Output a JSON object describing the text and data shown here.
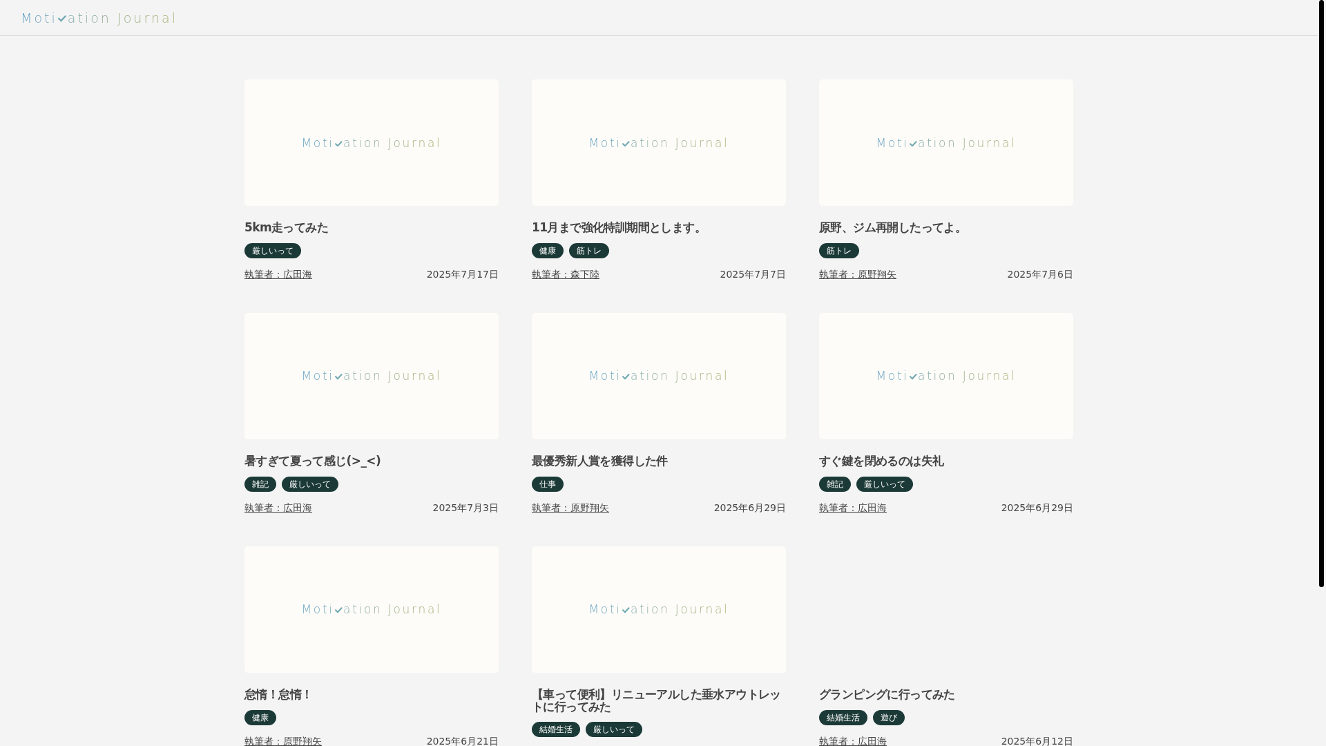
{
  "header": {
    "logo": {
      "before": "Moti",
      "after": "ation Journal"
    }
  },
  "posts": [
    {
      "thumbnail": {
        "before": "Moti",
        "after": "ation Journal"
      },
      "title": "5km走ってみた",
      "tags": [
        "厳しいって"
      ],
      "author": "執筆者：広田海",
      "date": "2025年7月17日"
    },
    {
      "thumbnail": {
        "before": "Moti",
        "after": "ation Journal"
      },
      "title": "11月まで強化特訓期間とします。",
      "tags": [
        "健康",
        "筋トレ"
      ],
      "author": "執筆者：森下陸",
      "date": "2025年7月7日"
    },
    {
      "thumbnail": {
        "before": "Moti",
        "after": "ation Journal"
      },
      "title": "原野、ジム再開したってよ。",
      "tags": [
        "筋トレ"
      ],
      "author": "執筆者：原野翔矢",
      "date": "2025年7月6日"
    },
    {
      "thumbnail": {
        "before": "Moti",
        "after": "ation Journal"
      },
      "title": "暑すぎて夏って感じ(>_<)",
      "tags": [
        "雑記",
        "厳しいって"
      ],
      "author": "執筆者：広田海",
      "date": "2025年7月3日"
    },
    {
      "thumbnail": {
        "before": "Moti",
        "after": "ation Journal"
      },
      "title": "最優秀新人賞を獲得した件",
      "tags": [
        "仕事"
      ],
      "author": "執筆者：原野翔矢",
      "date": "2025年6月29日"
    },
    {
      "thumbnail": {
        "before": "Moti",
        "after": "ation Journal"
      },
      "title": "すぐ鍵を閉めるのは失礼",
      "tags": [
        "雑記",
        "厳しいって"
      ],
      "author": "執筆者：広田海",
      "date": "2025年6月29日"
    },
    {
      "thumbnail": {
        "before": "Moti",
        "after": "ation Journal"
      },
      "title": "怠惰！怠惰！",
      "tags": [
        "健康"
      ],
      "author": "執筆者：原野翔矢",
      "date": "2025年6月21日"
    },
    {
      "thumbnail": {
        "before": "Moti",
        "after": "ation Journal"
      },
      "title": "【車って便利】リニューアルした垂水アウトレットに行ってみた",
      "tags": [
        "結婚生活",
        "厳しいって"
      ]
    },
    {
      "title": "グランピングに行ってみた",
      "tags": [
        "結婚生活",
        "遊び"
      ],
      "author": "執筆者：広田海",
      "date": "2025年6月12日"
    }
  ]
}
